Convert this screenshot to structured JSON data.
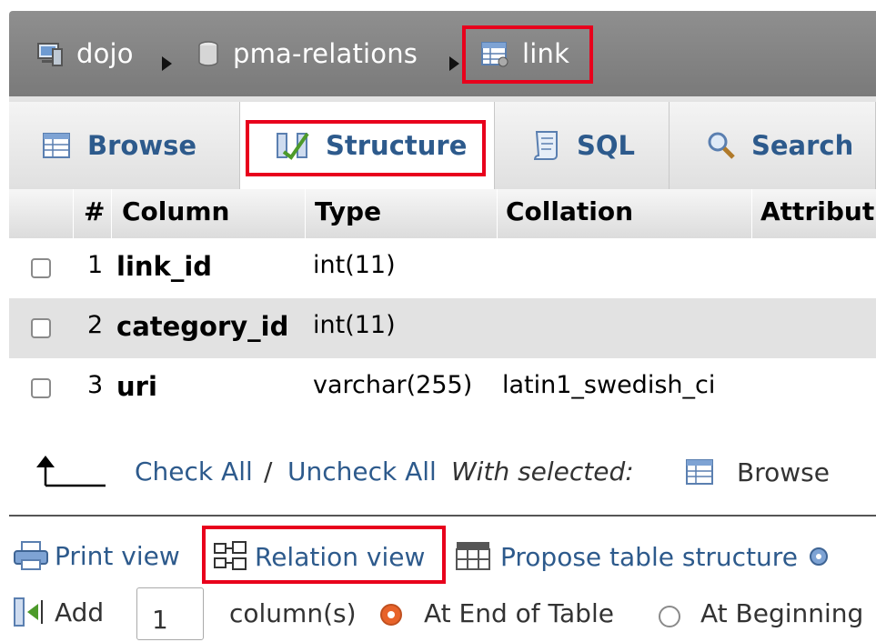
{
  "breadcrumb": {
    "server": "dojo",
    "database": "pma-relations",
    "table": "link"
  },
  "tabs": [
    {
      "label": "Browse",
      "active": false
    },
    {
      "label": "Structure",
      "active": true
    },
    {
      "label": "SQL",
      "active": false
    },
    {
      "label": "Search",
      "active": false
    }
  ],
  "table": {
    "headers": {
      "num": "#",
      "column": "Column",
      "type": "Type",
      "collation": "Collation",
      "attributes": "Attribut"
    },
    "rows": [
      {
        "num": "1",
        "name": "link_id",
        "type": "int(11)",
        "collation": ""
      },
      {
        "num": "2",
        "name": "category_id",
        "type": "int(11)",
        "collation": ""
      },
      {
        "num": "3",
        "name": "uri",
        "type": "varchar(255)",
        "collation": "latin1_swedish_ci"
      }
    ]
  },
  "bulk": {
    "check_all": "Check All",
    "separator": "/",
    "uncheck_all": "Uncheck All",
    "with_selected": "With selected:",
    "browse": "Browse"
  },
  "tools": {
    "print_view": "Print view",
    "relation_view": "Relation view",
    "propose_structure": "Propose table structure"
  },
  "add_column": {
    "add_label": "Add",
    "count": "1",
    "columns_label": "column(s)",
    "at_end": "At End of Table",
    "at_beginning": "At Beginning"
  },
  "colors": {
    "link": "#2d5a8c",
    "highlight": "#e8001c",
    "radio_selected": "#e8632a"
  }
}
